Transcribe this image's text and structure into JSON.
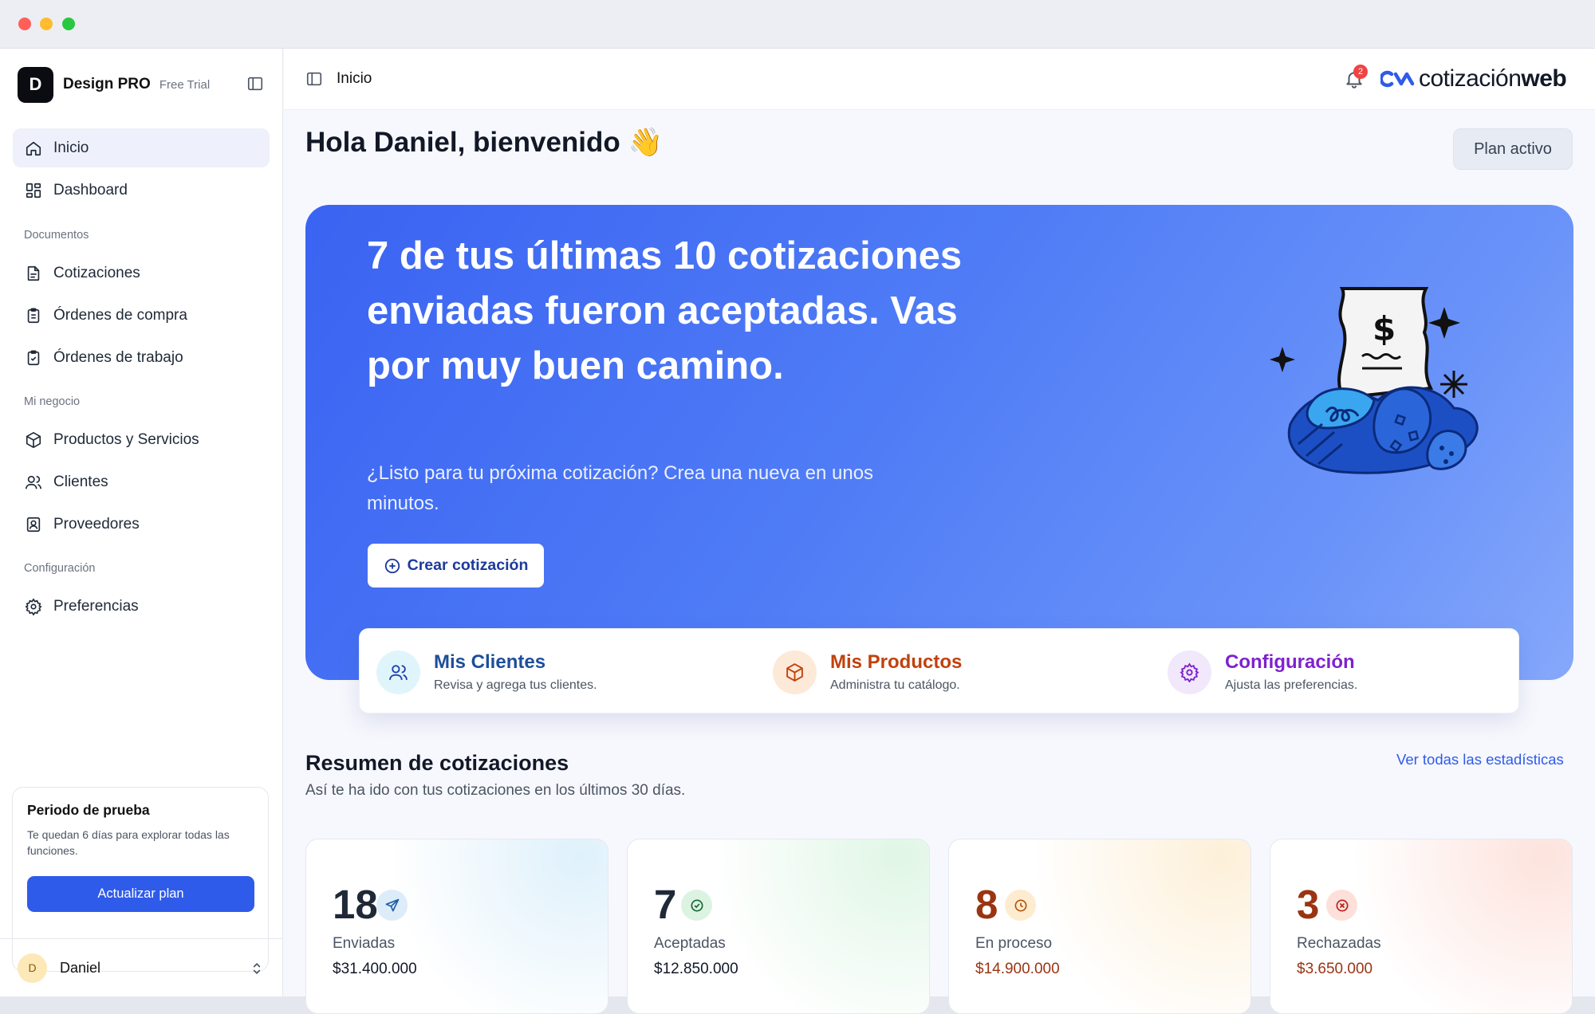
{
  "sidebar": {
    "brand_initial": "D",
    "brand_name": "Design PRO",
    "brand_badge": "Free Trial",
    "items": [
      {
        "label": "Inicio",
        "icon": "home-icon",
        "active": true
      },
      {
        "label": "Dashboard",
        "icon": "grid-icon"
      },
      {
        "label": "Cotizaciones",
        "icon": "document-icon"
      },
      {
        "label": "Órdenes de compra",
        "icon": "clipboard-list-icon"
      },
      {
        "label": "Órdenes de trabajo",
        "icon": "clipboard-check-icon"
      },
      {
        "label": "Productos y Servicios",
        "icon": "box-icon"
      },
      {
        "label": "Clientes",
        "icon": "users-icon"
      },
      {
        "label": "Proveedores",
        "icon": "contact-book-icon"
      },
      {
        "label": "Preferencias",
        "icon": "gear-icon"
      }
    ],
    "sections": [
      "Documentos",
      "Mi negocio",
      "Configuración"
    ],
    "trial": {
      "title": "Periodo de prueba",
      "text": "Te quedan 6 días para explorar todas las funciones.",
      "button": "Actualizar plan"
    },
    "user": {
      "initial": "D",
      "name": "Daniel"
    }
  },
  "topbar": {
    "breadcrumb": "Inicio",
    "notifications": "2",
    "logo_text_regular": "cotización",
    "logo_text_bold": "web"
  },
  "main": {
    "greeting": "Hola Daniel, bienvenido 👋",
    "plan_button": "Plan activo",
    "hero": {
      "title": "7 de tus últimas 10 cotizaciones enviadas fueron aceptadas. Vas por muy buen camino.",
      "subtitle": "¿Listo para tu próxima cotización? Crea una nueva en unos minutos.",
      "button": "Crear cotización"
    },
    "quick_actions": [
      {
        "title": "Mis Clientes",
        "desc": "Revisa y agrega tus clientes.",
        "color": "#1d4ed8"
      },
      {
        "title": "Mis Productos",
        "desc": "Administra tu catálogo.",
        "color": "#c2410c"
      },
      {
        "title": "Configuración",
        "desc": "Ajusta las preferencias.",
        "color": "#7e22ce"
      }
    ],
    "summary": {
      "title": "Resumen de cotizaciones",
      "subtitle": "Así te ha ido con tus cotizaciones en los últimos 30 días.",
      "link": "Ver todas las estadísticas"
    },
    "stats": [
      {
        "count": "18",
        "label": "Enviadas",
        "amount": "$31.400.000",
        "color": "#1f2937",
        "amount_color": "#111827"
      },
      {
        "count": "7",
        "label": "Aceptadas",
        "amount": "$12.850.000",
        "color": "#1f2937",
        "amount_color": "#111827"
      },
      {
        "count": "8",
        "label": "En proceso",
        "amount": "$14.900.000",
        "color": "#9a3412",
        "amount_color": "#9a3412"
      },
      {
        "count": "3",
        "label": "Rechazadas",
        "amount": "$3.650.000",
        "color": "#9a3412",
        "amount_color": "#9a3412"
      }
    ]
  }
}
